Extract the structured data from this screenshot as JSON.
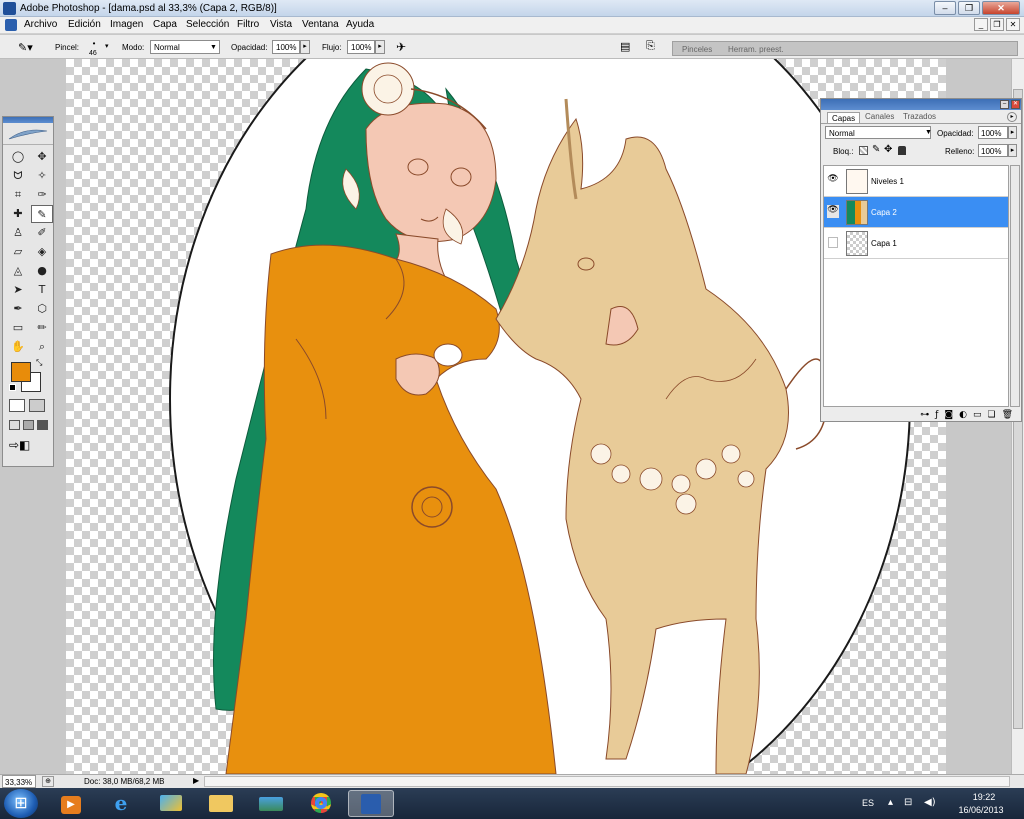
{
  "window": {
    "title": "Adobe Photoshop - [dama.psd al 33,3% (Capa 2, RGB/8)]"
  },
  "menu": [
    "Archivo",
    "Edición",
    "Imagen",
    "Capa",
    "Selección",
    "Filtro",
    "Vista",
    "Ventana",
    "Ayuda"
  ],
  "options": {
    "brush_label": "Pincel:",
    "brush_size": "46",
    "mode_label": "Modo:",
    "mode_value": "Normal",
    "opacity_label": "Opacidad:",
    "opacity_value": "100%",
    "flow_label": "Flujo:",
    "flow_value": "100%"
  },
  "palette_well": {
    "tabs": [
      "Pinceles",
      "Herram. preest."
    ]
  },
  "colors": {
    "foreground": "#e88c0a",
    "background": "#ffffff",
    "hair": "#14895c",
    "dress": "#e8900e",
    "skin": "#f4c8b4",
    "unicorn": "#e8cb98",
    "line": "#8a4a2a"
  },
  "layers_panel": {
    "tabs": [
      "Capas",
      "Canales",
      "Trazados"
    ],
    "blend_mode": "Normal",
    "opacity_label": "Opacidad:",
    "opacity_value": "100%",
    "lock_label": "Bloq.:",
    "fill_label": "Relleno:",
    "fill_value": "100%",
    "layers": [
      {
        "name": "Niveles 1",
        "visible": true,
        "active": false
      },
      {
        "name": "Capa 2",
        "visible": true,
        "active": true
      },
      {
        "name": "Capa 1",
        "visible": false,
        "active": false
      }
    ]
  },
  "status": {
    "zoom": "33,33%",
    "doc": "Doc: 38,0 MB/68,2 MB"
  },
  "taskbar": {
    "apps": [
      "media-player",
      "internet-explorer",
      "paint",
      "file-explorer",
      "photos",
      "chrome",
      "photoshop"
    ],
    "language": "ES",
    "time": "19:22",
    "date": "16/06/2013"
  }
}
